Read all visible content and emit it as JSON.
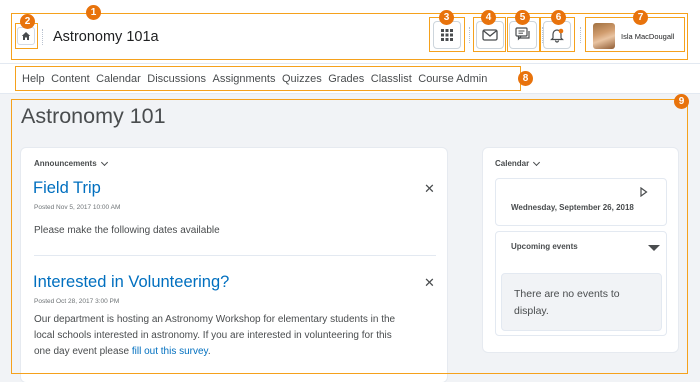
{
  "header": {
    "course_title": "Astronomy 101a",
    "user_name": "Isla MacDougall",
    "icons": [
      "home-icon",
      "waffle-grid-icon",
      "mail-icon",
      "chat-icon",
      "bell-icon"
    ]
  },
  "nav": {
    "items": [
      "Help",
      "Content",
      "Calendar",
      "Discussions",
      "Assignments",
      "Quizzes",
      "Grades",
      "Classlist",
      "Course Admin"
    ]
  },
  "main": {
    "page_title": "Astronomy 101",
    "announcements": {
      "widget_title": "Announcements",
      "items": [
        {
          "title": "Field Trip",
          "posted": "Posted Nov 5, 2017 10:00 AM",
          "body": "Please make the following dates available"
        },
        {
          "title": "Interested in Volunteering?",
          "posted": "Posted Oct 28, 2017 3:00 PM",
          "body_line1": "Our department is hosting an Astronomy Workshop for elementary students in the",
          "body_line2": "local schools interested in astronomy. If you are interested in volunteering for this",
          "body_line3_prefix": "one day event please ",
          "link": "fill out this survey",
          "body_line3_suffix": "."
        }
      ]
    },
    "calendar": {
      "widget_title": "Calendar",
      "date": "Wednesday, September 26, 2018",
      "upcoming_label": "Upcoming events",
      "no_events_line1": "There are no events to",
      "no_events_line2": "display."
    }
  },
  "callouts": [
    "1",
    "2",
    "3",
    "4",
    "5",
    "6",
    "7",
    "8",
    "9"
  ],
  "colors": {
    "annotation_orange": "#e8730c",
    "link_blue": "#006fbf",
    "frame_orange": "#f5a11c"
  }
}
